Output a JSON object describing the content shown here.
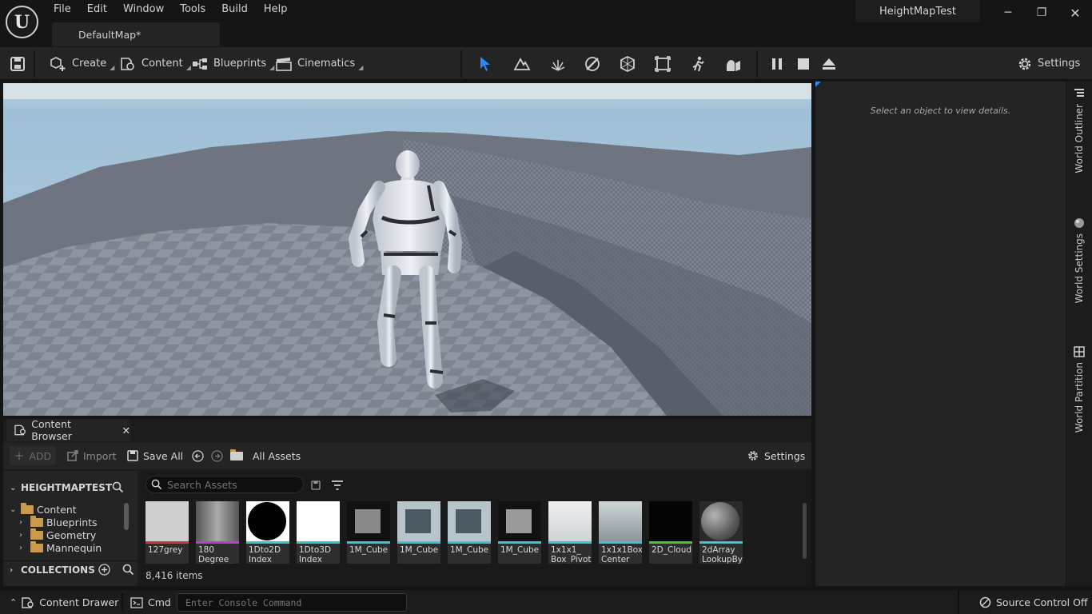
{
  "app": {
    "logo_letter": "U",
    "project_name": "HeightMapTest"
  },
  "menu": [
    "File",
    "Edit",
    "Window",
    "Tools",
    "Build",
    "Help"
  ],
  "level_tab": {
    "label": "DefaultMap*"
  },
  "window_controls": {
    "minimize": "─",
    "restore": "❐",
    "close": "✕"
  },
  "toolbar": {
    "create": "Create",
    "content": "Content",
    "blueprints": "Blueprints",
    "cinematics": "Cinematics",
    "settings": "Settings",
    "modes": [
      "select-mode-icon",
      "landscape-mode-icon",
      "foliage-mode-icon",
      "mesh-paint-mode-icon",
      "fracture-mode-icon",
      "brush-edit-mode-icon",
      "animation-mode-icon",
      "modeling-mode-icon"
    ]
  },
  "details": {
    "empty_message": "Select an object to view details."
  },
  "side_tabs": [
    "World Outliner",
    "World Settings",
    "World Partition"
  ],
  "content_browser": {
    "tab_label": "Content Browser",
    "add_label": "ADD",
    "import_label": "Import",
    "save_all_label": "Save All",
    "path_label": "All Assets",
    "settings_label": "Settings",
    "project_header": "HEIGHTMAPTEST",
    "collections_header": "COLLECTIONS",
    "tree": [
      {
        "label": "Content",
        "level": 0,
        "expanded": true
      },
      {
        "label": "Blueprints",
        "level": 1
      },
      {
        "label": "Geometry",
        "level": 1
      },
      {
        "label": "Mannequin",
        "level": 1
      }
    ],
    "search_placeholder": "Search Assets",
    "item_count": "8,416 items",
    "assets": [
      {
        "label": "127grey",
        "bar": "#d23a3a",
        "thumb": "#cfcfcf",
        "kind": "flat"
      },
      {
        "label": "180 Degree_",
        "bar": "#c03bd6",
        "thumb": "#8a8a8a",
        "kind": "gradient"
      },
      {
        "label": "1Dto2D Index",
        "bar": "#39c7d6",
        "thumb": "#000000",
        "kind": "circle"
      },
      {
        "label": "1Dto3D Index",
        "bar": "#39c7d6",
        "thumb": "#ffffff",
        "kind": "flat"
      },
      {
        "label": "1M_Cube",
        "bar": "#39c7d6",
        "thumb": "#111111",
        "kind": "cube"
      },
      {
        "label": "1M_Cube",
        "bar": "#39c7d6",
        "thumb": "#4d5a63",
        "kind": "cube"
      },
      {
        "label": "1M_Cube",
        "bar": "#39c7d6",
        "thumb": "#4d5a63",
        "kind": "cube"
      },
      {
        "label": "1M_Cube",
        "bar": "#39c7d6",
        "thumb": "#111111",
        "kind": "cube"
      },
      {
        "label": "1x1x1_ Box_Pivot",
        "bar": "#39c7d6",
        "thumb": "#e4e4e4",
        "kind": "plane"
      },
      {
        "label": "1x1x1Box Center",
        "bar": "#39c7d6",
        "thumb": "#a8b0b3",
        "kind": "plane"
      },
      {
        "label": "2D_Cloud",
        "bar": "#4fbf3c",
        "thumb": "#050505",
        "kind": "flat"
      },
      {
        "label": "2dArray LookupBy",
        "bar": "#39c7d6",
        "thumb": "#6c6c6c",
        "kind": "sphere"
      }
    ]
  },
  "statusbar": {
    "content_drawer": "Content Drawer",
    "cmd": "Cmd",
    "console_placeholder": "Enter Console Command",
    "source_control": "Source Control Off"
  }
}
